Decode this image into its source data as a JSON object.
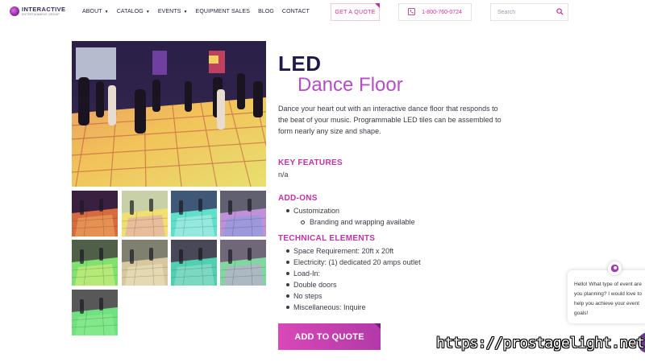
{
  "header": {
    "logo": {
      "name": "INTERACTIVE",
      "sub": "ENTERTAINMENT GROUP"
    },
    "nav": [
      {
        "label": "ABOUT",
        "has_dropdown": true
      },
      {
        "label": "CATALOG",
        "has_dropdown": true
      },
      {
        "label": "EVENTS",
        "has_dropdown": true
      },
      {
        "label": "EQUIPMENT SALES",
        "has_dropdown": false
      },
      {
        "label": "BLOG",
        "has_dropdown": false
      },
      {
        "label": "CONTACT",
        "has_dropdown": false
      }
    ],
    "get_quote_label": "GET A QUOTE",
    "phone": "1-800-760-0724",
    "search_placeholder": "Search"
  },
  "product": {
    "title_main": "LED",
    "title_sub": "Dance Floor",
    "description": "Dance your heart out with an interactive dance floor that responds to the beat of your music. Programmable LED tiles can be assembled to form nearly any size and shape.",
    "key_features_heading": "KEY FEATURES",
    "key_features_value": "n/a",
    "addons_heading": "ADD-ONS",
    "addons": [
      {
        "label": "Customization",
        "sub": false
      },
      {
        "label": "Branding and wrapping available",
        "sub": true
      }
    ],
    "technical_heading": "TECHNICAL ELEMENTS",
    "technical": [
      "Space Requirement: 20ft x 20ft",
      "Electricity: (1) dedicated 20 amps outlet",
      "Load-In:",
      "Double doors",
      "No steps",
      "Miscellaneous: Inquire"
    ],
    "add_to_quote_label": "ADD TO QUOTE"
  },
  "chat": {
    "message_lines": [
      "Hello! What type of event are",
      "you planning? I would love to",
      "help you achieve your event",
      "goals!"
    ]
  },
  "watermark": "https://prostagelight.net",
  "colors": {
    "accent": "#c032a8",
    "title_dark": "#1e1a4a",
    "title_purple": "#b64cc8"
  }
}
